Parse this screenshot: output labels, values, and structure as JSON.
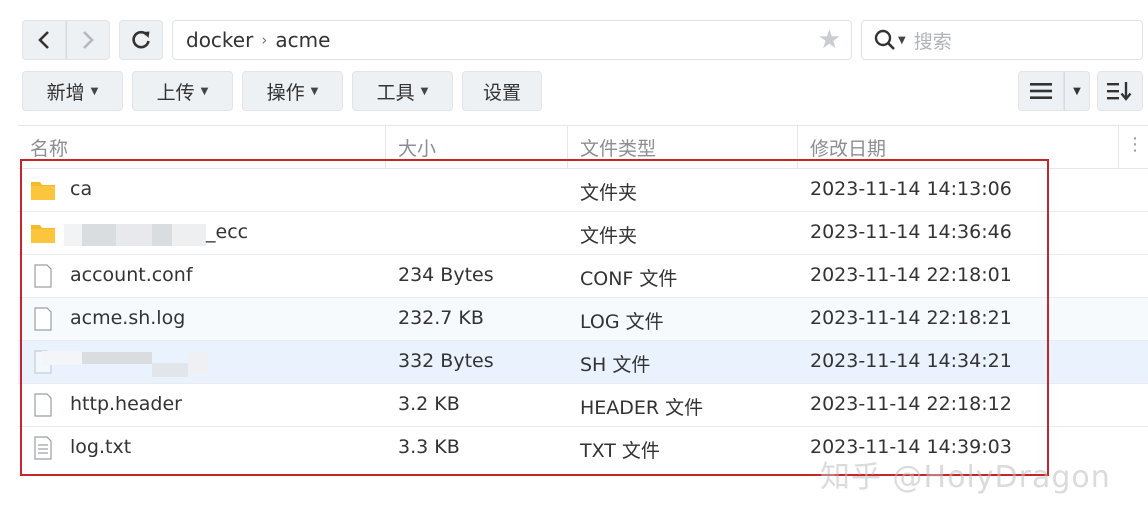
{
  "nav": {
    "back_icon": "chevron-left-icon",
    "forward_icon": "chevron-right-icon",
    "refresh_icon": "refresh-icon"
  },
  "path": {
    "segments": [
      "docker",
      "acme"
    ],
    "separator": "›"
  },
  "search": {
    "placeholder": "搜索"
  },
  "toolbar": {
    "create_label": "新增",
    "upload_label": "上传",
    "action_label": "操作",
    "tools_label": "工具",
    "settings_label": "设置"
  },
  "columns": {
    "name": "名称",
    "size": "大小",
    "type": "文件类型",
    "modified": "修改日期"
  },
  "rows": [
    {
      "name": "ca",
      "size": "",
      "type": "文件夹",
      "modified": "2023-11-14 14:13:06",
      "icon": "folder-icon"
    },
    {
      "name": "_ecc",
      "size": "",
      "type": "文件夹",
      "modified": "2023-11-14 14:36:46",
      "icon": "folder-icon"
    },
    {
      "name": "account.conf",
      "size": "234 Bytes",
      "type": "CONF 文件",
      "modified": "2023-11-14 22:18:01",
      "icon": "file-icon"
    },
    {
      "name": "acme.sh.log",
      "size": "232.7 KB",
      "type": "LOG 文件",
      "modified": "2023-11-14 22:18:21",
      "icon": "file-icon"
    },
    {
      "name": "",
      "size": "332 Bytes",
      "type": "SH 文件",
      "modified": "2023-11-14 14:34:21",
      "icon": "file-icon"
    },
    {
      "name": "http.header",
      "size": "3.2 KB",
      "type": "HEADER 文件",
      "modified": "2023-11-14 22:18:12",
      "icon": "file-icon"
    },
    {
      "name": "log.txt",
      "size": "3.3 KB",
      "type": "TXT 文件",
      "modified": "2023-11-14 14:39:03",
      "icon": "text-file-icon"
    }
  ],
  "watermark": "知乎 @HolyDragon",
  "colors": {
    "accent_red": "#c8242b",
    "folder": "#f8b928",
    "selected_row": "#eaf3fd"
  }
}
